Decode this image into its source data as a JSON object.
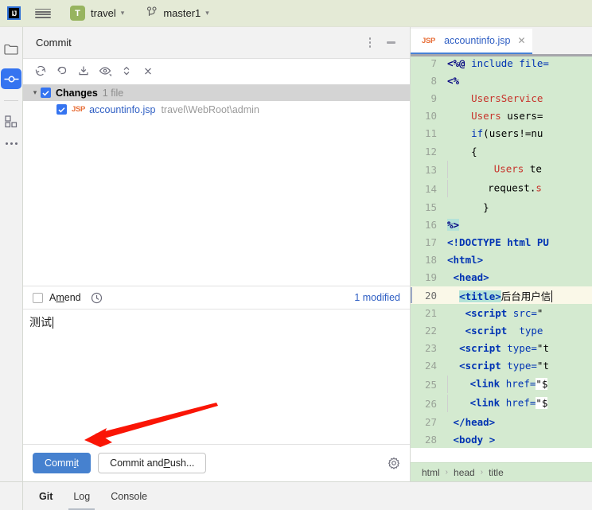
{
  "titlebar": {
    "logo": "IJ",
    "menu_icon": "hamburger-icon",
    "project": {
      "avatar_letter": "T",
      "name": "travel"
    },
    "branch": {
      "icon": "branch-icon",
      "name": "master1"
    }
  },
  "toolstrip": {
    "items": [
      {
        "name": "project-tool-window",
        "icon": "folder-icon"
      },
      {
        "name": "commit-tool-window",
        "icon": "commit-icon",
        "active": true
      },
      {
        "name": "structure-tool-window",
        "icon": "structure-icon"
      },
      {
        "name": "more-tool-windows",
        "icon": "ellipsis-icon"
      }
    ]
  },
  "commit_panel": {
    "title": "Commit",
    "header_actions": [
      {
        "name": "options-button",
        "icon": "vertical-ellipsis-icon"
      },
      {
        "name": "minimize-button",
        "icon": "minimize-icon"
      }
    ],
    "toolbar": [
      {
        "name": "refresh-changes-button",
        "icon": "refresh-icon"
      },
      {
        "name": "rollback-button",
        "icon": "revert-icon"
      },
      {
        "name": "shelve-button",
        "icon": "shelve-icon"
      },
      {
        "name": "preview-diff-button",
        "icon": "eye-icon"
      },
      {
        "name": "expand-collapse-button",
        "icon": "chevron-updown-icon"
      },
      {
        "name": "collapse-all-button",
        "icon": "close-x-icon"
      }
    ],
    "changes": {
      "group_label": "Changes",
      "group_count": "1 file",
      "files": [
        {
          "type_badge": "JSP",
          "name": "accountinfo.jsp",
          "path": "travel\\WebRoot\\admin",
          "checked": true
        }
      ]
    },
    "amend": {
      "label_pre": "A",
      "label_accel": "m",
      "label_post": "end",
      "checked": false
    },
    "history_icon": "clock-icon",
    "modified_status": "1 modified",
    "message": "测试",
    "buttons": {
      "commit": {
        "pre": "Comm",
        "accel": "i",
        "post": "t"
      },
      "commit_and_push": {
        "pre": "Commit and ",
        "accel": "P",
        "post": "ush..."
      },
      "settings_icon": "gear-icon"
    }
  },
  "editor": {
    "tab": {
      "type_badge": "JSP",
      "name": "accountinfo.jsp",
      "close_icon": "close-icon"
    },
    "lines": [
      {
        "num": "7",
        "html": "<span class='pct'>&lt;%@</span> <span class='kw'>include</span> <span class='kw'>file=</span>"
      },
      {
        "num": "8",
        "html": "<span class='pct'>&lt;%</span>"
      },
      {
        "num": "9",
        "html": "    <span class='cls'>UsersService</span>"
      },
      {
        "num": "10",
        "html": "    <span class='cls'>Users</span> users="
      },
      {
        "num": "11",
        "html": "    <span class='kw'>if</span>(users!=nu"
      },
      {
        "num": "12",
        "html": "    {"
      },
      {
        "num": "13",
        "html": "<span class='ind'></span>       <span class='cls'>Users</span> te"
      },
      {
        "num": "14",
        "html": "<span class='ind'></span>      request.<span class='cls'>s</span>"
      },
      {
        "num": "15",
        "html": "      }"
      },
      {
        "num": "16",
        "html": "<span class='sel'><span class='pct'>%&gt;</span></span>"
      },
      {
        "num": "17",
        "html": "<span class='tag'>&lt;!DOCTYPE</span> <span class='tag'>html</span> <span class='tag'>PU</span>"
      },
      {
        "num": "18",
        "html": "<span class='tag'>&lt;html&gt;</span>"
      },
      {
        "num": "19",
        "html": " <span class='tag'>&lt;head&gt;</span>"
      },
      {
        "num": "20",
        "html": "  <span class='sel'><span class='tag'>&lt;title&gt;</span></span><span class='cnm'>后台用户信</span>",
        "current": true
      },
      {
        "num": "21",
        "html": "   <span class='tag'>&lt;script</span> <span class='kw'>src=</span>\""
      },
      {
        "num": "22",
        "html": "   <span class='tag'>&lt;script</span>  <span class='kw'>type</span>"
      },
      {
        "num": "23",
        "html": "  <span class='tag'>&lt;script</span> <span class='kw'>type=</span>\"t"
      },
      {
        "num": "24",
        "html": "  <span class='tag'>&lt;script</span> <span class='kw'>type=</span>\"t"
      },
      {
        "num": "25",
        "html": "<span class='ind'></span>   <span class='tag'>&lt;link</span> <span class='kw'>href=</span><span class='strhl'>\"$</span>"
      },
      {
        "num": "26",
        "html": "<span class='ind'></span>   <span class='tag'>&lt;link</span> <span class='kw'>href=</span><span class='strhl'>\"$</span>"
      },
      {
        "num": "27",
        "html": " <span class='tag'>&lt;/head&gt;</span>"
      },
      {
        "num": "28",
        "html": " <span class='tag'>&lt;body</span> <span class='tag'>&gt;</span>"
      }
    ],
    "breadcrumb": [
      "html",
      "head",
      "title"
    ]
  },
  "bottom_tabs": [
    {
      "label": "Git",
      "active": true
    },
    {
      "label": "Log",
      "underlined": true
    },
    {
      "label": "Console"
    }
  ],
  "annotation": {
    "name": "red-arrow-to-commit-button",
    "color": "#fa1505"
  }
}
